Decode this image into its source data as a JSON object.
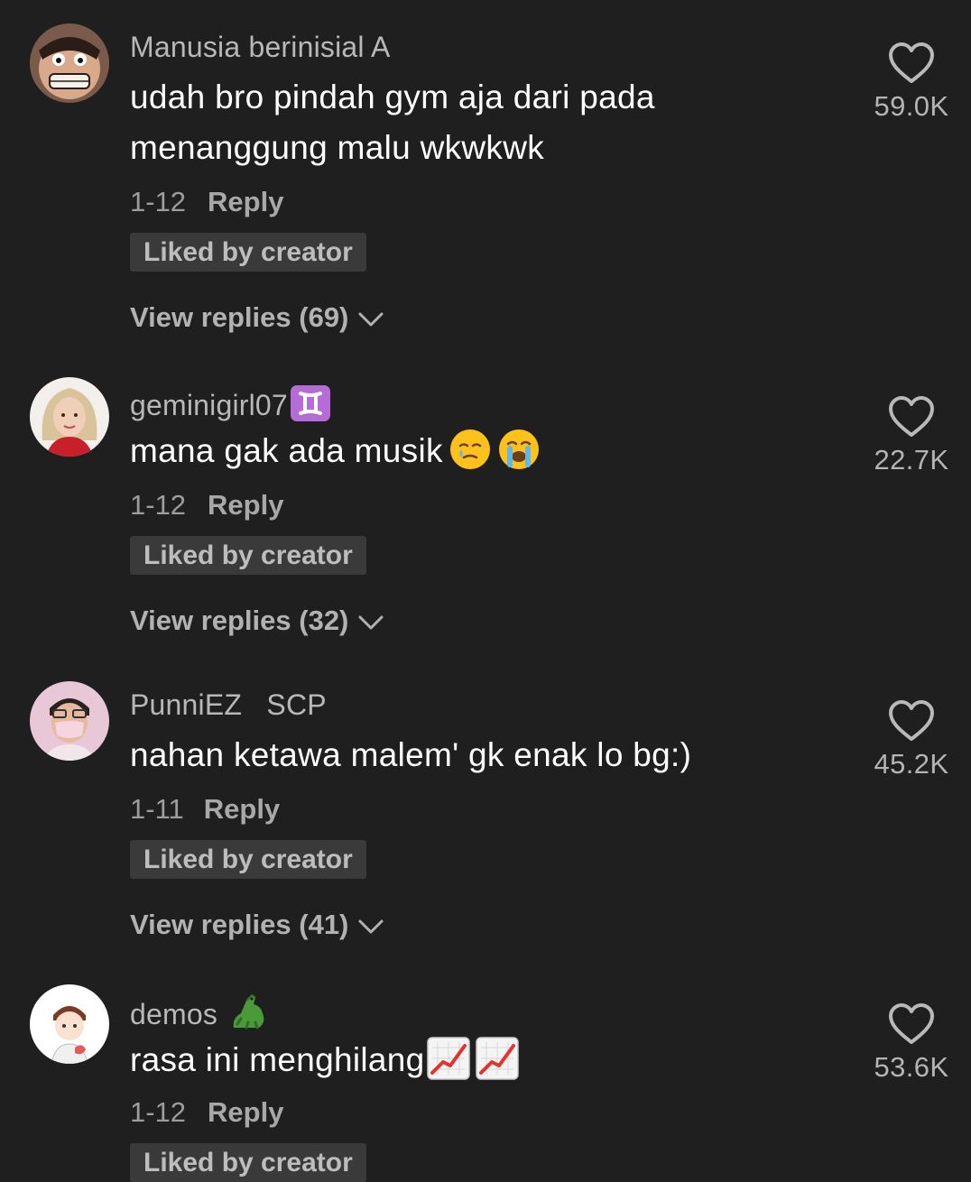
{
  "comments": [
    {
      "username": "Manusia berinisial A",
      "text": "udah bro pindah gym aja dari pada menanggung malu wkwkwk",
      "date": "1-12",
      "reply_label": "Reply",
      "liked_label": "Liked by creator",
      "view_replies": "View replies (69)",
      "likes": "59.0K",
      "avatar_icon": "cartoon-face-avatar"
    },
    {
      "username": "geminigirl07",
      "username_badge": "gemini-emoji",
      "text": "mana gak ada musik",
      "text_emojis": [
        "smiling-tear-emoji",
        "crying-emoji"
      ],
      "date": "1-12",
      "reply_label": "Reply",
      "liked_label": "Liked by creator",
      "view_replies": "View replies (32)",
      "likes": "22.7K",
      "avatar_icon": "blonde-woman-avatar"
    },
    {
      "username": "PunniEZ   SCP",
      "text": "nahan ketawa malem' gk enak lo bg:)",
      "date": "1-11",
      "reply_label": "Reply",
      "liked_label": "Liked by creator",
      "view_replies": "View replies (41)",
      "likes": "45.2K",
      "avatar_icon": "masked-person-avatar"
    },
    {
      "username": "demos",
      "username_badge": "crocodile-emoji",
      "text": "rasa ini menghilang",
      "text_emojis": [
        "chart-increasing-emoji",
        "chart-increasing-emoji"
      ],
      "date": "1-12",
      "reply_label": "Reply",
      "liked_label": "Liked by creator",
      "likes": "53.6K",
      "avatar_icon": "cartoon-person-avatar"
    }
  ],
  "colors": {
    "background": "#1f1f1f",
    "text_primary": "#ffffff",
    "text_secondary": "#b8b8b8",
    "liked_badge_bg": "#3a3a3a"
  }
}
